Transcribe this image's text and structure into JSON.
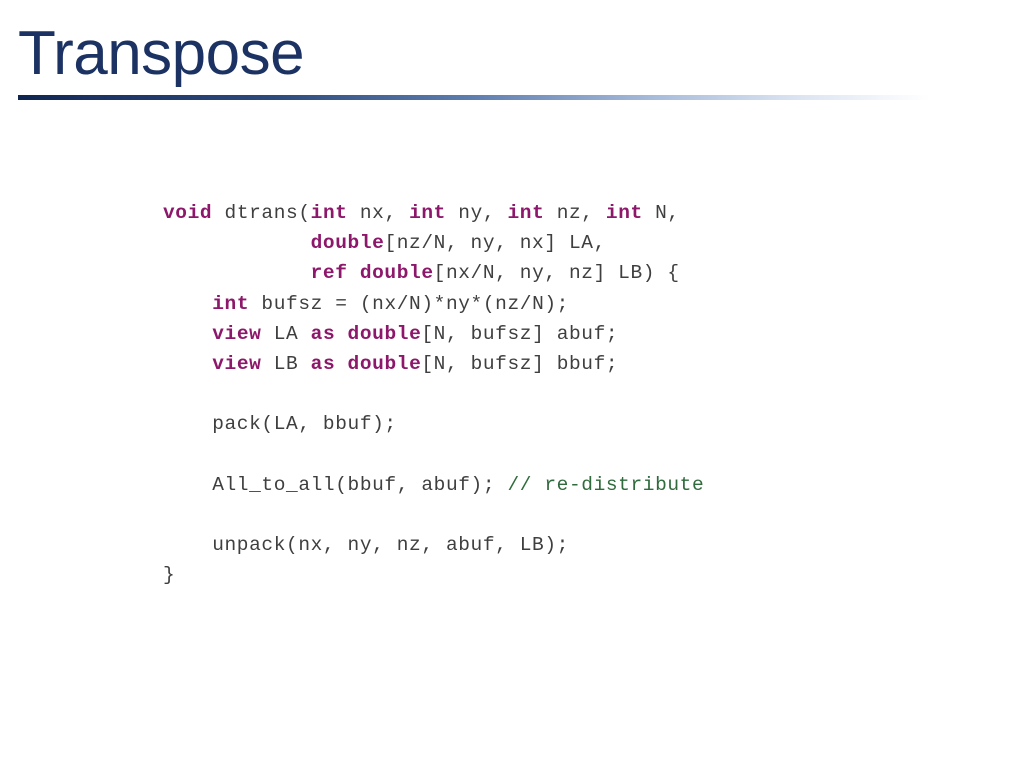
{
  "slide": {
    "title": "Transpose",
    "title_color": "#1b3263",
    "rule_color_start": "#0f2550",
    "rule_color_end": "#ffffff",
    "background": "#ffffff"
  },
  "code": {
    "keyword_color": "#8d186b",
    "plain_color": "#3f3f3f",
    "comment_color": "#2f6b3c",
    "lines": [
      {
        "id": "line-1",
        "text": "void dtrans(int nx, int ny, int nz, int N,",
        "tokens": [
          {
            "t": "void",
            "k": "kw"
          },
          {
            "t": " dtrans(",
            "k": "plain"
          },
          {
            "t": "int",
            "k": "kw"
          },
          {
            "t": " nx, ",
            "k": "plain"
          },
          {
            "t": "int",
            "k": "kw"
          },
          {
            "t": " ny, ",
            "k": "plain"
          },
          {
            "t": "int",
            "k": "kw"
          },
          {
            "t": " nz, ",
            "k": "plain"
          },
          {
            "t": "int",
            "k": "kw"
          },
          {
            "t": " N,",
            "k": "plain"
          }
        ]
      },
      {
        "id": "line-2",
        "text": "            double[nz/N, ny, nx] LA,",
        "tokens": [
          {
            "t": "            ",
            "k": "plain"
          },
          {
            "t": "double",
            "k": "kw"
          },
          {
            "t": "[nz/N, ny, nx] LA,",
            "k": "plain"
          }
        ]
      },
      {
        "id": "line-3",
        "text": "            ref double[nx/N, ny, nz] LB) {",
        "tokens": [
          {
            "t": "            ",
            "k": "plain"
          },
          {
            "t": "ref double",
            "k": "kw"
          },
          {
            "t": "[nx/N, ny, nz] LB) {",
            "k": "plain"
          }
        ]
      },
      {
        "id": "line-4",
        "text": "    int bufsz = (nx/N)*ny*(nz/N);",
        "tokens": [
          {
            "t": "    ",
            "k": "plain"
          },
          {
            "t": "int",
            "k": "kw"
          },
          {
            "t": " bufsz = (nx/N)*ny*(nz/N);",
            "k": "plain"
          }
        ]
      },
      {
        "id": "line-5",
        "text": "    view LA as double[N, bufsz] abuf;",
        "tokens": [
          {
            "t": "    ",
            "k": "plain"
          },
          {
            "t": "view",
            "k": "kw"
          },
          {
            "t": " LA ",
            "k": "plain"
          },
          {
            "t": "as double",
            "k": "kw"
          },
          {
            "t": "[N, bufsz] abuf;",
            "k": "plain"
          }
        ]
      },
      {
        "id": "line-6",
        "text": "    view LB as double[N, bufsz] bbuf;",
        "tokens": [
          {
            "t": "    ",
            "k": "plain"
          },
          {
            "t": "view",
            "k": "kw"
          },
          {
            "t": " LB ",
            "k": "plain"
          },
          {
            "t": "as double",
            "k": "kw"
          },
          {
            "t": "[N, bufsz] bbuf;",
            "k": "plain"
          }
        ]
      },
      {
        "id": "line-7",
        "text": "",
        "tokens": []
      },
      {
        "id": "line-8",
        "text": "    pack(LA, bbuf);",
        "tokens": [
          {
            "t": "    pack(LA, bbuf);",
            "k": "plain"
          }
        ]
      },
      {
        "id": "line-9",
        "text": "",
        "tokens": []
      },
      {
        "id": "line-10",
        "text": "    All_to_all(bbuf, abuf); // re-distribute",
        "tokens": [
          {
            "t": "    All_to_all(bbuf, abuf); ",
            "k": "plain"
          },
          {
            "t": "// re-distribute",
            "k": "comment"
          }
        ]
      },
      {
        "id": "line-11",
        "text": "",
        "tokens": []
      },
      {
        "id": "line-12",
        "text": "    unpack(nx, ny, nz, abuf, LB);",
        "tokens": [
          {
            "t": "    unpack(nx, ny, nz, abuf, LB);",
            "k": "plain"
          }
        ]
      },
      {
        "id": "line-13",
        "text": "}",
        "tokens": [
          {
            "t": "}",
            "k": "plain"
          }
        ]
      }
    ]
  }
}
